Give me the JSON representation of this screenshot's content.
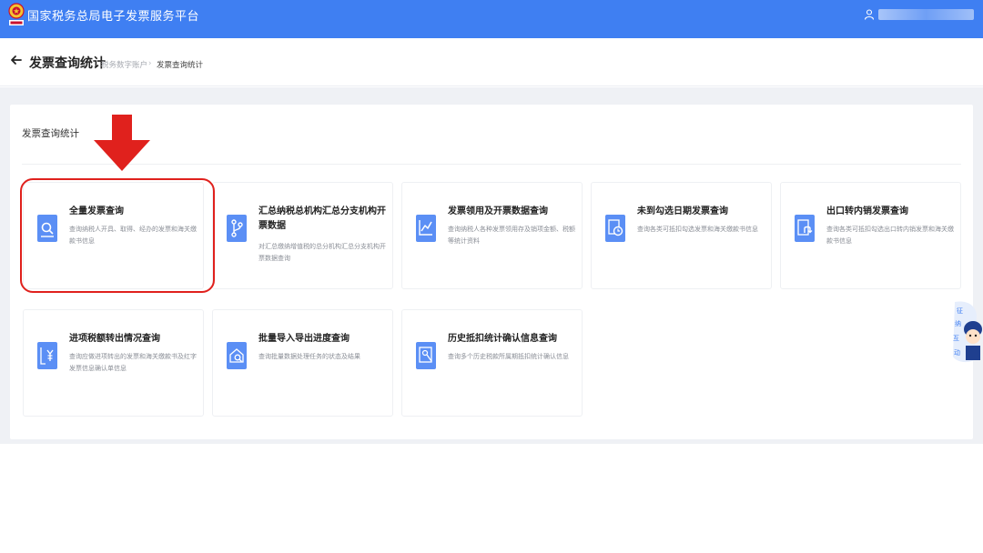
{
  "header": {
    "app_title": "国家税务总局电子发票服务平台",
    "user_name": "郝",
    "bg_color": "#3f7ff2"
  },
  "breadcrumb": {
    "page_title": "发票查询统计",
    "items": [
      "税务数字账户",
      "发票查询统计"
    ],
    "separator": "›"
  },
  "section": {
    "title": "发票查询统计"
  },
  "cards": [
    {
      "title": "全量发票查询",
      "desc": "查询纳税人开具、取得、经办的发票和海关缴款书信息",
      "icon": "search-doc-icon"
    },
    {
      "title": "汇总纳税总机构汇总分支机构开票数据",
      "desc": "对汇总缴纳增值税的总分机构汇总分支机构开票数据查询",
      "icon": "branch-icon"
    },
    {
      "title": "发票领用及开票数据查询",
      "desc": "查询纳税人各种发票领用存及销项金额、税额等统计资料",
      "icon": "chart-doc-icon"
    },
    {
      "title": "未到勾选日期发票查询",
      "desc": "查询各类可抵扣勾选发票和海关缴款书信息",
      "icon": "clock-doc-icon"
    },
    {
      "title": "出口转内销发票查询",
      "desc": "查询各类可抵扣勾选出口转内销发票和海关缴款书信息",
      "icon": "return-doc-icon"
    },
    {
      "title": "进项税额转出情况查询",
      "desc": "查询应做进项转出的发票和海关缴款书及红字发票信息确认单信息",
      "icon": "yen-doc-icon"
    },
    {
      "title": "批量导入导出进度查询",
      "desc": "查询批量数据处理任务的状态及结果",
      "icon": "folder-search-icon"
    },
    {
      "title": "历史抵扣统计确认信息查询",
      "desc": "查询多个历史税款所属期抵扣统计确认信息",
      "icon": "image-search-icon"
    }
  ],
  "helper": {
    "label": "征纳互动"
  },
  "colors": {
    "accent": "#3f7ff2",
    "icon_bg": "#5b8ff5",
    "highlight": "#e0211d"
  }
}
